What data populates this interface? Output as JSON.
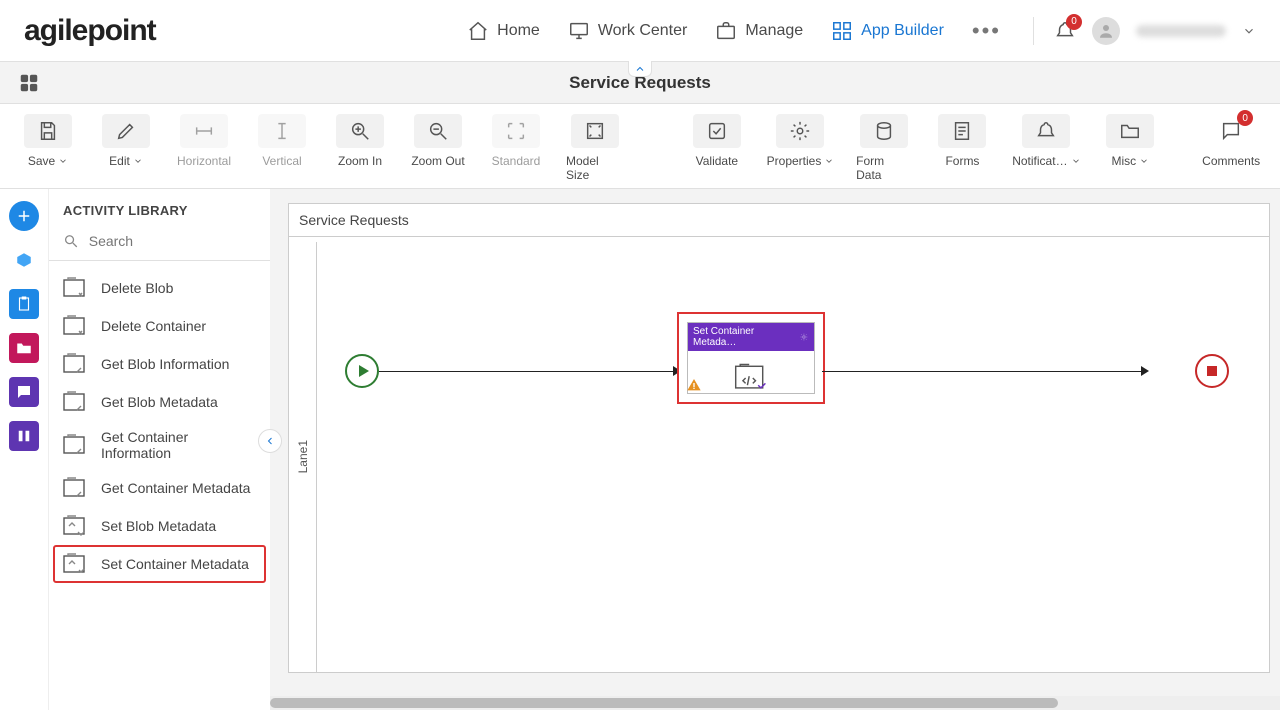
{
  "header": {
    "logo": "agilepoint",
    "nav": {
      "home": "Home",
      "work_center": "Work Center",
      "manage": "Manage",
      "app_builder": "App Builder"
    },
    "notification_count": "0",
    "username": "————"
  },
  "subheader": {
    "title": "Service Requests"
  },
  "toolbar": {
    "save": "Save",
    "edit": "Edit",
    "horizontal": "Horizontal",
    "vertical": "Vertical",
    "zoom_in": "Zoom In",
    "zoom_out": "Zoom Out",
    "standard": "Standard",
    "model_size": "Model Size",
    "validate": "Validate",
    "properties": "Properties",
    "form_data": "Form Data",
    "forms": "Forms",
    "notifications": "Notificat…",
    "misc": "Misc",
    "comments": "Comments",
    "comments_count": "0"
  },
  "sidebar": {
    "title": "ACTIVITY LIBRARY",
    "search_placeholder": "Search",
    "items": [
      {
        "label": "Delete Blob"
      },
      {
        "label": "Delete Container"
      },
      {
        "label": "Get Blob Information"
      },
      {
        "label": "Get Blob Metadata"
      },
      {
        "label": "Get Container Information"
      },
      {
        "label": "Get Container Metadata"
      },
      {
        "label": "Set Blob Metadata"
      },
      {
        "label": "Set Container Metadata"
      }
    ]
  },
  "canvas": {
    "title": "Service Requests",
    "lane": "Lane1",
    "activity_title": "Set Container Metada…"
  }
}
